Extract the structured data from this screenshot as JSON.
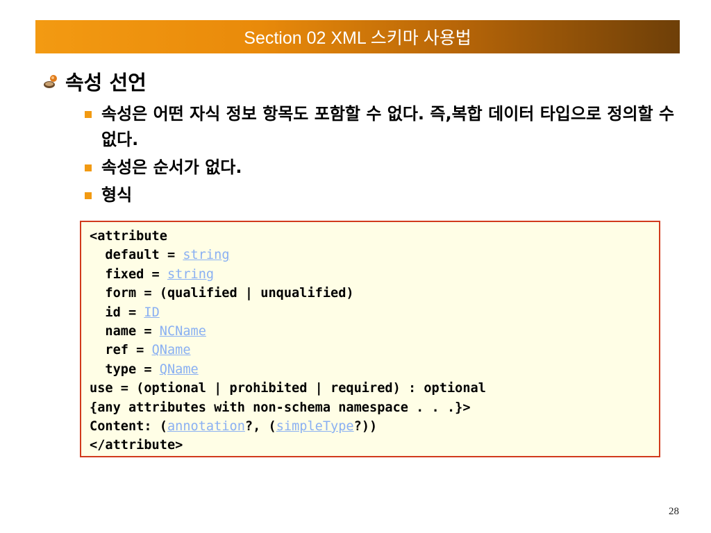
{
  "slide": {
    "title": "Section 02 XML 스키마 사용법",
    "heading": "속성 선언",
    "bullets": [
      "속성은 어떤 자식 정보 항목도 포함할 수 없다. 즉,복합 데이터 타입으로 정의할 수 없다.",
      "속성은 순서가 없다.",
      "형식"
    ],
    "code": [
      {
        "text": "<attribute"
      },
      {
        "text": "  default = ",
        "link": "string"
      },
      {
        "text": "  fixed = ",
        "link": "string"
      },
      {
        "text": "  form = (qualified | unqualified)"
      },
      {
        "text": "  id = ",
        "link": "ID"
      },
      {
        "text": "  name = ",
        "link": "NCName"
      },
      {
        "text": "  ref = ",
        "link": "QName"
      },
      {
        "text": "  type = ",
        "link": "QName"
      },
      {
        "text": "use = (optional | prohibited | required) : optional"
      },
      {
        "text": "{any attributes with non-schema namespace . . .}>"
      },
      {
        "text": "Content: (",
        "link": "annotation",
        "mid": "?, (",
        "link2": "simpleType",
        "tail": "?))"
      },
      {
        "text": "</attribute>"
      }
    ],
    "page_number": "28"
  },
  "colors": {
    "banner_start": "#f39a12",
    "banner_end": "#6e3f08",
    "bullet_square": "#f29a12",
    "code_border": "#d13a1c",
    "code_background": "#fffee6",
    "link": "#8ab0f2"
  },
  "icons": {
    "heading_icon": "person-bullet-icon",
    "bullet_icon": "orange-square-icon"
  }
}
